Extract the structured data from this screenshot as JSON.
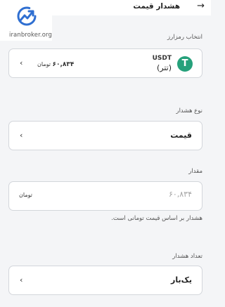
{
  "header": {
    "title": "هشدار قیمت",
    "back_icon": "arrow-right-icon"
  },
  "logo": {
    "text": "iranbroker.org",
    "icon": "growth-chart-logo-icon",
    "color": "#2f6fd1"
  },
  "currency": {
    "label": "انتخاب رمزارز",
    "symbol": "USDT",
    "name": "(تتر)",
    "coin_glyph": "T",
    "price": "۶۰,۸۳۴",
    "unit": "تومان",
    "icon": "tether-coin-icon",
    "coin_color": "#26a17b"
  },
  "alert_type": {
    "label": "نوع هشدار",
    "value": "قیمت"
  },
  "amount": {
    "label": "مقدار",
    "placeholder": "۶۰,۸۳۴",
    "unit": "تومان",
    "hint": "هشدار بر اساس قیمت تومانی است."
  },
  "alert_count": {
    "label": "تعداد هشدار",
    "value": "یک‌بار"
  },
  "icons": {
    "chevron": "‹",
    "back_arrow": "→"
  }
}
